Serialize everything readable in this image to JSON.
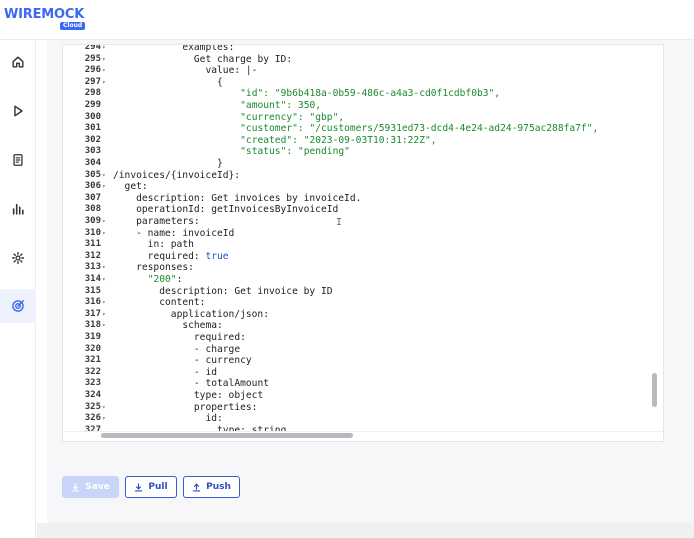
{
  "brand": {
    "name": "WIREMOCK",
    "sub": "Cloud",
    "accent": "#3d67f5"
  },
  "sidebar": {
    "items": [
      {
        "icon": "home-icon",
        "active": false
      },
      {
        "icon": "play-icon",
        "active": false
      },
      {
        "icon": "document-icon",
        "active": false
      },
      {
        "icon": "bar-chart-icon",
        "active": false
      },
      {
        "icon": "gear-icon",
        "active": false
      },
      {
        "icon": "target-icon",
        "active": true
      }
    ]
  },
  "editor": {
    "lines": [
      {
        "n": "294",
        "fold": true,
        "indent": 12,
        "parts": [
          [
            "k",
            "examples:"
          ]
        ]
      },
      {
        "n": "295",
        "fold": true,
        "indent": 14,
        "parts": [
          [
            "k",
            "Get charge by ID:"
          ]
        ]
      },
      {
        "n": "296",
        "fold": true,
        "indent": 16,
        "parts": [
          [
            "k",
            "value: "
          ],
          [
            "k",
            "|-"
          ]
        ]
      },
      {
        "n": "297",
        "fold": true,
        "indent": 18,
        "parts": [
          [
            "k",
            "{"
          ]
        ]
      },
      {
        "n": "298",
        "fold": false,
        "indent": 22,
        "parts": [
          [
            "s",
            "\"id\": \"9b6b418a-0b59-486c-a4a3-cd0f1cdbf0b3\","
          ]
        ]
      },
      {
        "n": "299",
        "fold": false,
        "indent": 22,
        "parts": [
          [
            "s",
            "\"amount\": 350,"
          ]
        ]
      },
      {
        "n": "300",
        "fold": false,
        "indent": 22,
        "parts": [
          [
            "s",
            "\"currency\": \"gbp\","
          ]
        ]
      },
      {
        "n": "301",
        "fold": false,
        "indent": 22,
        "parts": [
          [
            "s",
            "\"customer\": \"/customers/5931ed73-dcd4-4e24-ad24-975ac288fa7f\","
          ]
        ]
      },
      {
        "n": "302",
        "fold": false,
        "indent": 22,
        "parts": [
          [
            "s",
            "\"created\": \"2023-09-03T10:31:22Z\","
          ]
        ]
      },
      {
        "n": "303",
        "fold": false,
        "indent": 22,
        "parts": [
          [
            "s",
            "\"status\": \"pending\""
          ]
        ]
      },
      {
        "n": "304",
        "fold": false,
        "indent": 18,
        "parts": [
          [
            "k",
            "}"
          ]
        ]
      },
      {
        "n": "305",
        "fold": true,
        "indent": 0,
        "parts": [
          [
            "k",
            "/invoices/{invoiceId}:"
          ]
        ]
      },
      {
        "n": "306",
        "fold": true,
        "indent": 2,
        "parts": [
          [
            "k",
            "get:"
          ]
        ]
      },
      {
        "n": "307",
        "fold": false,
        "indent": 4,
        "parts": [
          [
            "k",
            "description: Get invoices by invoiceId."
          ]
        ]
      },
      {
        "n": "308",
        "fold": false,
        "indent": 4,
        "parts": [
          [
            "k",
            "operationId: getInvoicesByInvoiceId"
          ]
        ]
      },
      {
        "n": "309",
        "fold": true,
        "indent": 4,
        "parts": [
          [
            "k",
            "parameters:"
          ]
        ]
      },
      {
        "n": "310",
        "fold": true,
        "indent": 4,
        "parts": [
          [
            "k",
            "- name: invoiceId"
          ]
        ]
      },
      {
        "n": "311",
        "fold": false,
        "indent": 6,
        "parts": [
          [
            "k",
            "in: path"
          ]
        ]
      },
      {
        "n": "312",
        "fold": false,
        "indent": 6,
        "parts": [
          [
            "k",
            "required: "
          ],
          [
            "b",
            "true"
          ]
        ]
      },
      {
        "n": "313",
        "fold": true,
        "indent": 4,
        "parts": [
          [
            "k",
            "responses:"
          ]
        ]
      },
      {
        "n": "314",
        "fold": true,
        "indent": 6,
        "parts": [
          [
            "s",
            "\"200\""
          ],
          [
            "k",
            ":"
          ]
        ]
      },
      {
        "n": "315",
        "fold": false,
        "indent": 8,
        "parts": [
          [
            "k",
            "description: Get invoice by ID"
          ]
        ]
      },
      {
        "n": "316",
        "fold": true,
        "indent": 8,
        "parts": [
          [
            "k",
            "content:"
          ]
        ]
      },
      {
        "n": "317",
        "fold": true,
        "indent": 10,
        "parts": [
          [
            "k",
            "application/json:"
          ]
        ]
      },
      {
        "n": "318",
        "fold": true,
        "indent": 12,
        "parts": [
          [
            "k",
            "schema:"
          ]
        ]
      },
      {
        "n": "319",
        "fold": false,
        "indent": 14,
        "parts": [
          [
            "k",
            "required:"
          ]
        ]
      },
      {
        "n": "320",
        "fold": false,
        "indent": 14,
        "parts": [
          [
            "k",
            "- charge"
          ]
        ]
      },
      {
        "n": "321",
        "fold": false,
        "indent": 14,
        "parts": [
          [
            "k",
            "- currency"
          ]
        ]
      },
      {
        "n": "322",
        "fold": false,
        "indent": 14,
        "parts": [
          [
            "k",
            "- id"
          ]
        ]
      },
      {
        "n": "323",
        "fold": false,
        "indent": 14,
        "parts": [
          [
            "k",
            "- totalAmount"
          ]
        ]
      },
      {
        "n": "324",
        "fold": false,
        "indent": 14,
        "parts": [
          [
            "k",
            "type: object"
          ]
        ]
      },
      {
        "n": "325",
        "fold": true,
        "indent": 14,
        "parts": [
          [
            "k",
            "properties:"
          ]
        ]
      },
      {
        "n": "326",
        "fold": true,
        "indent": 16,
        "parts": [
          [
            "k",
            "id:"
          ]
        ]
      },
      {
        "n": "327",
        "fold": false,
        "indent": 18,
        "parts": [
          [
            "k",
            "type: string"
          ]
        ]
      }
    ]
  },
  "actions": {
    "save_label": "Save",
    "pull_label": "Pull",
    "push_label": "Push"
  },
  "colors": {
    "string": "#1a8a2e",
    "boolean": "#1a56c4",
    "button_border": "#3a5bd6"
  }
}
